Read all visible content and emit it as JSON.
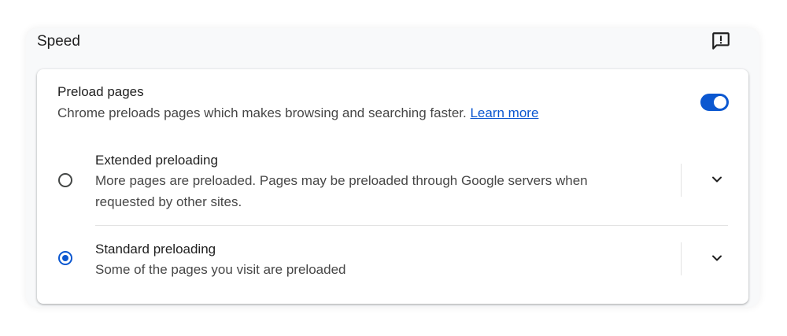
{
  "section": {
    "title": "Speed",
    "feedback_icon": "feedback-icon"
  },
  "preload": {
    "title": "Preload pages",
    "description": "Chrome preloads pages which makes browsing and searching faster.",
    "learn_more": "Learn more",
    "enabled": true
  },
  "options": [
    {
      "title": "Extended preloading",
      "description": "More pages are preloaded. Pages may be preloaded through Google servers when requested by other sites.",
      "selected": false
    },
    {
      "title": "Standard preloading",
      "description": "Some of the pages you visit are preloaded",
      "selected": true
    }
  ],
  "colors": {
    "accent": "#0b57d0",
    "text_primary": "#1f1f1f",
    "text_secondary": "#474747"
  }
}
